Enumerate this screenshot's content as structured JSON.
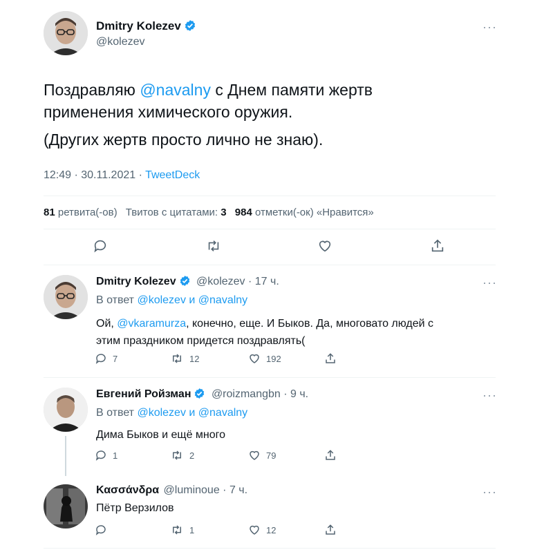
{
  "main_tweet": {
    "author_name": "Dmitry Kolezev",
    "handle": "@kolezev",
    "text_prefix": "Поздравляю ",
    "mention": "@navalny",
    "text_suffix_line1": " с Днем памяти жертв",
    "text_line2": "применения химического оружия.",
    "text_line3": "(Других жертв просто лично не знаю).",
    "time": "12:49 · 30.11.2021 · ",
    "source": "TweetDeck",
    "stats": {
      "retweets_count": "81",
      "retweets_label": "ретвита(-ов)",
      "quotes_label": "Твитов с цитатами:",
      "quotes_count": "3",
      "likes_count": "984",
      "likes_label": "отметки(-ок) «Нравится»"
    }
  },
  "replies": [
    {
      "author_name": "Dmitry Kolezev",
      "meta": "@kolezev · 17 ч.",
      "reply_to_prefix": "В ответ ",
      "reply_to_1": "@kolezev",
      "reply_to_and": " и ",
      "reply_to_2": "@navalny",
      "text_pre": "Ой, ",
      "text_mention": "@vkaramurza",
      "text_post": ", конечно, еще. И Быков. Да, многовато людей с",
      "text_line2": "этим праздником придется поздравлять(",
      "replies_count": "7",
      "retweets_count": "12",
      "likes_count": "192"
    },
    {
      "author_name": "Евгений Ройзман",
      "meta": "@roizmangbn · 9 ч.",
      "reply_to_prefix": "В ответ ",
      "reply_to_1": "@kolezev",
      "reply_to_and": " и ",
      "reply_to_2": "@navalny",
      "text": "Дима Быков и ещё много",
      "replies_count": "1",
      "retweets_count": "2",
      "likes_count": "79"
    },
    {
      "author_name": "Κασσάνδρα",
      "meta": "@luminoue · 7 ч.",
      "text": "Пётр Верзилов",
      "retweets_count": "1",
      "likes_count": "12"
    }
  ],
  "icons": {
    "verified": "verified-badge-icon",
    "more": "more-dots-icon",
    "reply": "reply-icon",
    "retweet": "retweet-icon",
    "like": "heart-icon",
    "share": "share-icon"
  },
  "colors": {
    "accent": "#1d9bf0",
    "text": "#0f1419",
    "secondary": "#536471",
    "divider": "#eff3f4"
  }
}
